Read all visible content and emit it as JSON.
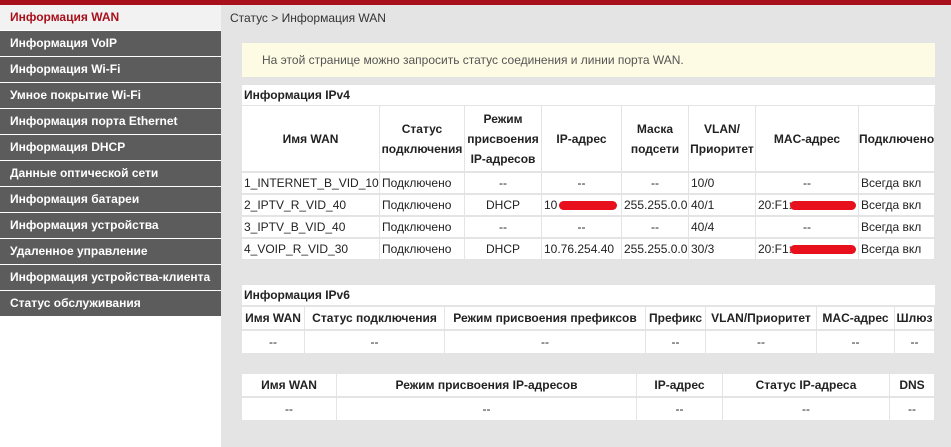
{
  "sidebar": {
    "items": [
      {
        "label": "Информация WAN",
        "active": true
      },
      {
        "label": "Информация VoIP"
      },
      {
        "label": "Информация Wi-Fi"
      },
      {
        "label": "Умное покрытие Wi-Fi"
      },
      {
        "label": "Информация порта Ethernet"
      },
      {
        "label": "Информация DHCP"
      },
      {
        "label": "Данные оптической сети"
      },
      {
        "label": "Информация батареи"
      },
      {
        "label": "Информация устройства"
      },
      {
        "label": "Удаленное управление"
      },
      {
        "label": "Информация устройства-клиента"
      },
      {
        "label": "Статус обслуживания"
      }
    ]
  },
  "breadcrumb": "Статус > Информация WAN",
  "notice": "На этой странице можно запросить статус соединения и линии порта WAN.",
  "ipv4": {
    "title": "Информация IPv4",
    "headers": [
      "Имя WAN",
      "Статус подключения",
      "Режим присвоения IP-адресов",
      "IP-адрес",
      "Маска подсети",
      "VLAN/ Приоритет",
      "MAC-адрес",
      "Подключено"
    ],
    "rows": [
      [
        "1_INTERNET_B_VID_10",
        "Подключено",
        "--",
        "--",
        "--",
        "10/0",
        "--",
        "Всегда вкл"
      ],
      [
        "2_IPTV_R_VID_40",
        "Подключено",
        "DHCP",
        "10",
        "255.255.0.0",
        "40/1",
        "20:F1:",
        "Всегда вкл"
      ],
      [
        "3_IPTV_B_VID_40",
        "Подключено",
        "--",
        "--",
        "--",
        "40/4",
        "--",
        "Всегда вкл"
      ],
      [
        "4_VOIP_R_VID_30",
        "Подключено",
        "DHCP",
        "10.76.254.40",
        "255.255.0.0",
        "30/3",
        "20:F1:",
        "Всегда вкл"
      ]
    ]
  },
  "ipv6": {
    "title": "Информация IPv6",
    "headers": [
      "Имя WAN",
      "Статус подключения",
      "Режим присвоения префиксов",
      "Префикс",
      "VLAN/Приоритет",
      "MAC-адрес",
      "Шлюз"
    ],
    "row": [
      "--",
      "--",
      "--",
      "--",
      "--",
      "--",
      "--"
    ]
  },
  "ipv6b": {
    "headers": [
      "Имя WAN",
      "Режим присвоения IP-адресов",
      "IP-адрес",
      "Статус IP-адреса",
      "DNS"
    ],
    "row": [
      "--",
      "--",
      "--",
      "--",
      "--"
    ]
  },
  "colors": {
    "accent": "#a8101c",
    "redact": "#e8101c"
  }
}
